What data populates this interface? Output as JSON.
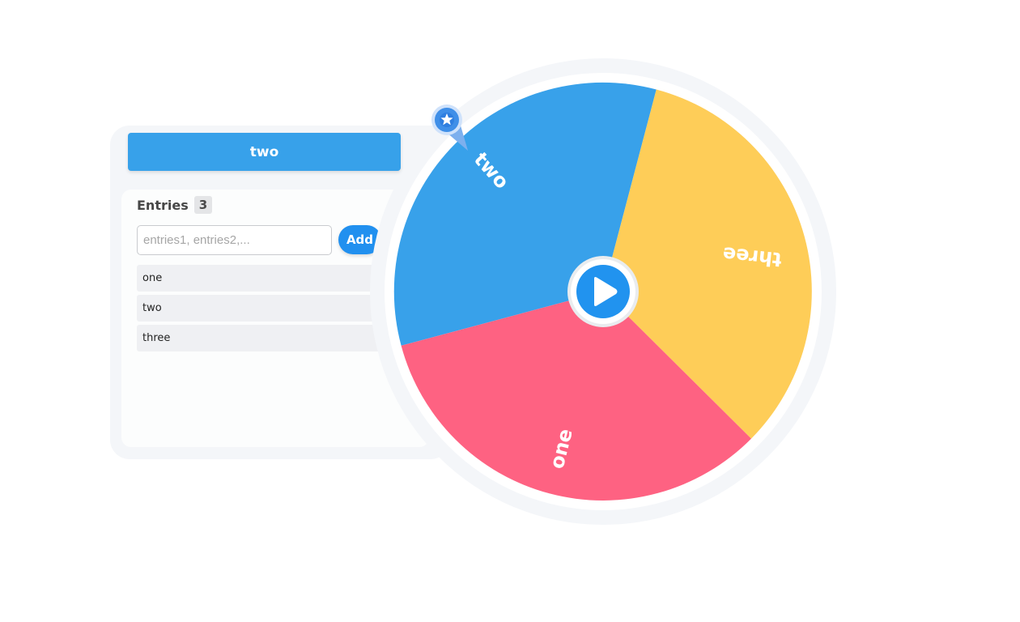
{
  "result": {
    "label": "two"
  },
  "entries": {
    "title": "Entries",
    "count": "3",
    "input": {
      "placeholder": "entries1, entries2,..."
    },
    "add_label": "Add",
    "items": [
      "one",
      "two",
      "three"
    ]
  },
  "wheel": {
    "slices": [
      {
        "label": "two",
        "color": "#38a1ea"
      },
      {
        "label": "three",
        "color": "#fecd58"
      },
      {
        "label": "one",
        "color": "#fe6282"
      }
    ],
    "ring_color": "#f4f6f9",
    "spin_button_color": "#2193ef",
    "pointer_icon": "star-pin-icon"
  }
}
